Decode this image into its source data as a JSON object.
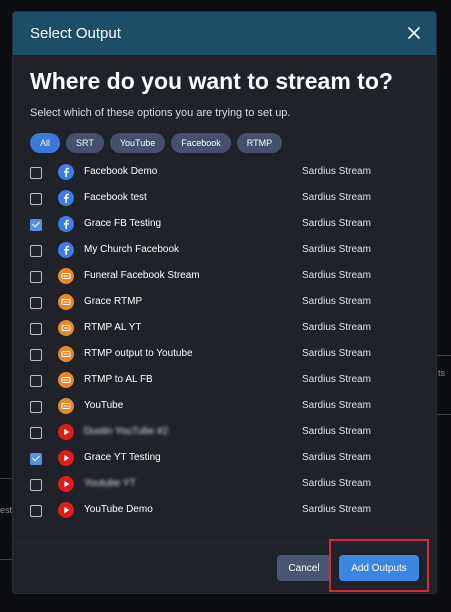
{
  "background": {
    "left_text": "esti",
    "right_text": "ts"
  },
  "modal": {
    "title": "Select Output",
    "close_icon": "close-icon",
    "headline": "Where do you want to stream to?",
    "subtitle": "Select which of these options you are trying to set up."
  },
  "filters": [
    {
      "label": "All",
      "active": true
    },
    {
      "label": "SRT",
      "active": false
    },
    {
      "label": "YouTube",
      "active": false
    },
    {
      "label": "Facebook",
      "active": false
    },
    {
      "label": "RTMP",
      "active": false
    }
  ],
  "outputs": [
    {
      "name": "Facebook Demo",
      "owner": "Sardius Stream",
      "type": "facebook",
      "icon": "facebook-icon",
      "checked": false,
      "blurred": false
    },
    {
      "name": "Facebook test",
      "owner": "Sardius Stream",
      "type": "facebook",
      "icon": "facebook-icon",
      "checked": false,
      "blurred": false
    },
    {
      "name": "Grace FB Testing",
      "owner": "Sardius Stream",
      "type": "facebook",
      "icon": "facebook-icon",
      "checked": true,
      "blurred": false
    },
    {
      "name": "My Church Facebook",
      "owner": "Sardius Stream",
      "type": "facebook",
      "icon": "facebook-icon",
      "checked": false,
      "blurred": false
    },
    {
      "name": "Funeral Facebook Stream",
      "owner": "Sardius Stream",
      "type": "rtmp",
      "icon": "rtmp-icon",
      "checked": false,
      "blurred": false
    },
    {
      "name": "Grace RTMP",
      "owner": "Sardius Stream",
      "type": "rtmp",
      "icon": "rtmp-icon",
      "checked": false,
      "blurred": false
    },
    {
      "name": "RTMP AL YT",
      "owner": "Sardius Stream",
      "type": "rtmp",
      "icon": "rtmp-icon",
      "checked": false,
      "blurred": false
    },
    {
      "name": "RTMP output to Youtube",
      "owner": "Sardius Stream",
      "type": "rtmp",
      "icon": "rtmp-icon",
      "checked": false,
      "blurred": false
    },
    {
      "name": "RTMP to AL FB",
      "owner": "Sardius Stream",
      "type": "rtmp",
      "icon": "rtmp-icon",
      "checked": false,
      "blurred": false
    },
    {
      "name": "YouTube",
      "owner": "Sardius Stream",
      "type": "rtmp",
      "icon": "rtmp-icon",
      "checked": false,
      "blurred": false
    },
    {
      "name": "Dustin YouTube #2",
      "owner": "Sardius Stream",
      "type": "youtube",
      "icon": "youtube-icon",
      "checked": false,
      "blurred": true
    },
    {
      "name": "Grace YT Testing",
      "owner": "Sardius Stream",
      "type": "youtube",
      "icon": "youtube-icon",
      "checked": true,
      "blurred": false
    },
    {
      "name": "Youtube YT",
      "owner": "Sardius Stream",
      "type": "youtube",
      "icon": "youtube-icon",
      "checked": false,
      "blurred": true
    },
    {
      "name": "YouTube Demo",
      "owner": "Sardius Stream",
      "type": "youtube",
      "icon": "youtube-icon",
      "checked": false,
      "blurred": false
    }
  ],
  "footer": {
    "cancel_label": "Cancel",
    "add_label": "Add Outputs"
  },
  "colors": {
    "header": "#1e4e67",
    "panel": "#1f2229",
    "accent": "#3a86e0",
    "highlight": "#d12a3a",
    "facebook": "#3b7de8",
    "rtmp": "#e8882a",
    "youtube": "#e01b1b"
  }
}
